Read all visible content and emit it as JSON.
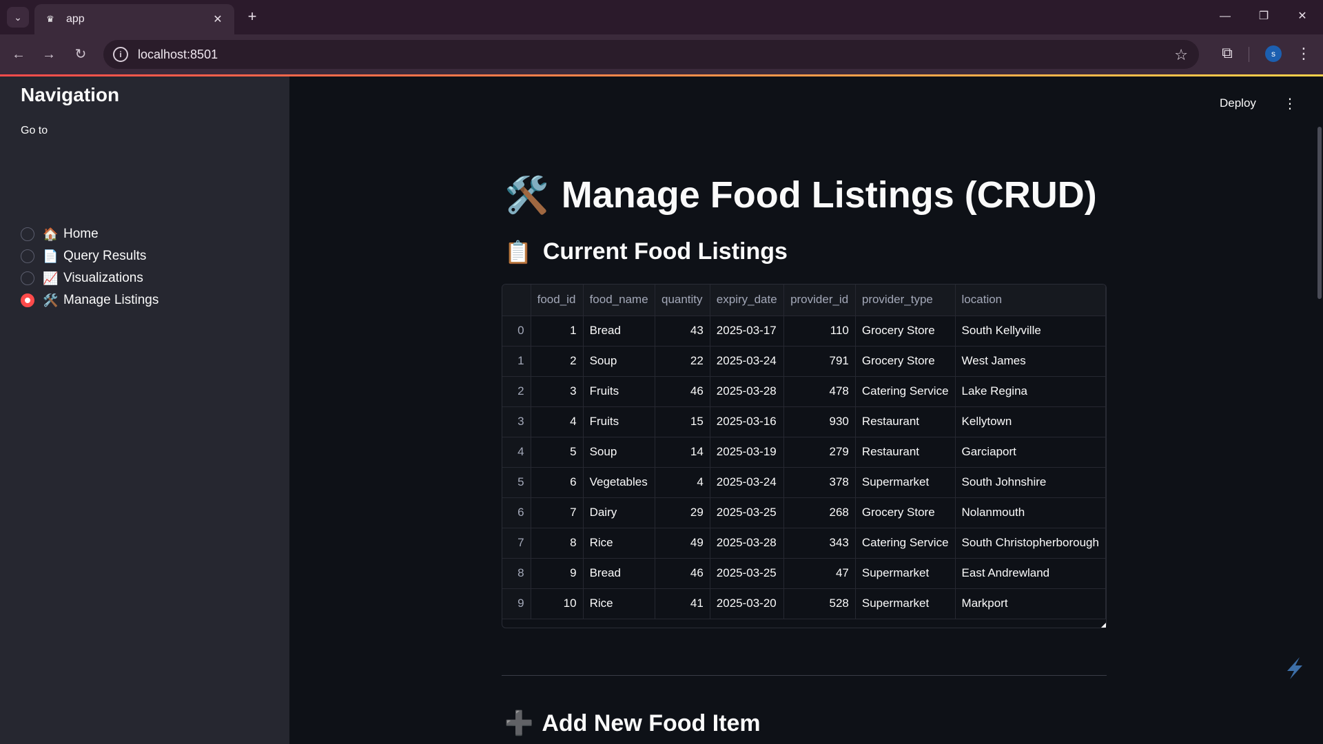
{
  "browser": {
    "tab_title": "app",
    "url": "localhost:8501",
    "avatar_letter": "s"
  },
  "sidebar": {
    "title": "Navigation",
    "goto_label": "Go to",
    "items": [
      {
        "emoji": "🏠",
        "label": "Home",
        "selected": false
      },
      {
        "emoji": "📄",
        "label": "Query Results",
        "selected": false
      },
      {
        "emoji": "📈",
        "label": "Visualizations",
        "selected": false
      },
      {
        "emoji": "🛠️",
        "label": "Manage Listings",
        "selected": true
      }
    ]
  },
  "header": {
    "deploy_label": "Deploy"
  },
  "page": {
    "title_icon": "🛠️",
    "title": "Manage Food Listings (CRUD)",
    "section_icon": "📋",
    "section_title": "Current Food Listings",
    "add_icon": "➕",
    "add_title": "Add New Food Item"
  },
  "table": {
    "columns": [
      "",
      "food_id",
      "food_name",
      "quantity",
      "expiry_date",
      "provider_id",
      "provider_type",
      "location"
    ],
    "rows": [
      [
        "0",
        "1",
        "Bread",
        "43",
        "2025-03-17",
        "110",
        "Grocery Store",
        "South Kellyville"
      ],
      [
        "1",
        "2",
        "Soup",
        "22",
        "2025-03-24",
        "791",
        "Grocery Store",
        "West James"
      ],
      [
        "2",
        "3",
        "Fruits",
        "46",
        "2025-03-28",
        "478",
        "Catering Service",
        "Lake Regina"
      ],
      [
        "3",
        "4",
        "Fruits",
        "15",
        "2025-03-16",
        "930",
        "Restaurant",
        "Kellytown"
      ],
      [
        "4",
        "5",
        "Soup",
        "14",
        "2025-03-19",
        "279",
        "Restaurant",
        "Garciaport"
      ],
      [
        "5",
        "6",
        "Vegetables",
        "4",
        "2025-03-24",
        "378",
        "Supermarket",
        "South Johnshire"
      ],
      [
        "6",
        "7",
        "Dairy",
        "29",
        "2025-03-25",
        "268",
        "Grocery Store",
        "Nolanmouth"
      ],
      [
        "7",
        "8",
        "Rice",
        "49",
        "2025-03-28",
        "343",
        "Catering Service",
        "South Christopherborough"
      ],
      [
        "8",
        "9",
        "Bread",
        "46",
        "2025-03-25",
        "47",
        "Supermarket",
        "East Andrewland"
      ],
      [
        "9",
        "10",
        "Rice",
        "41",
        "2025-03-20",
        "528",
        "Supermarket",
        "Markport"
      ]
    ]
  }
}
